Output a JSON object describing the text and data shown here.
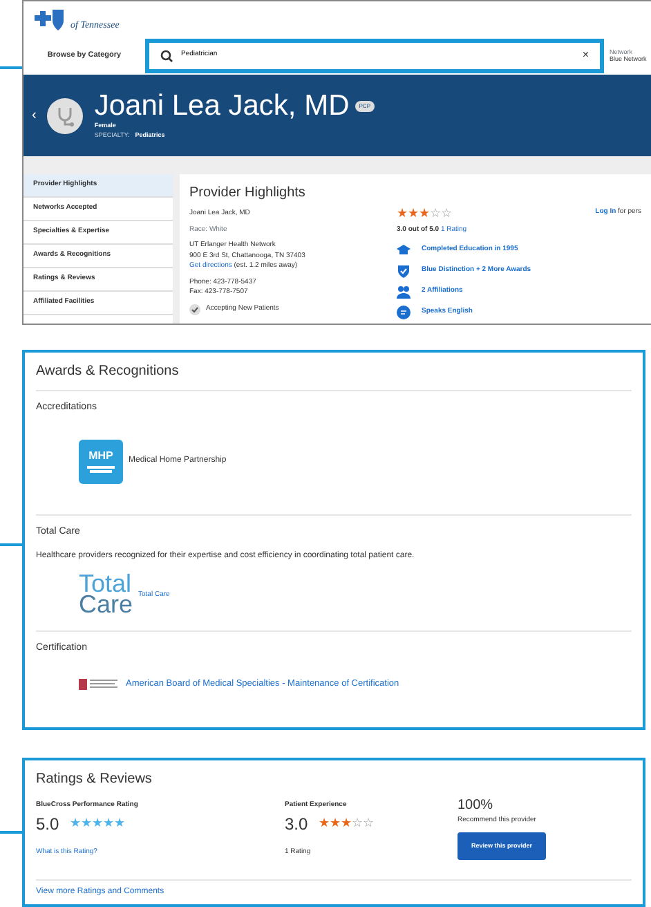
{
  "header": {
    "logo_text": "of Tennessee",
    "browse": "Browse by Category",
    "search": {
      "value": "Pediatrician",
      "clear": "×"
    },
    "network_label": "Network",
    "network_value": "Blue Network"
  },
  "profile": {
    "back": "‹",
    "name": "Joani Lea Jack, MD",
    "badge": "PCP",
    "gender": "Female",
    "specialty_label": "SPECIALTY:",
    "specialty": "Pediatrics"
  },
  "sidebar": {
    "items": [
      {
        "label": "Provider Highlights",
        "selected": true
      },
      {
        "label": "Networks Accepted",
        "selected": false
      },
      {
        "label": "Specialties & Expertise",
        "selected": false
      },
      {
        "label": "Awards & Recognitions",
        "selected": false
      },
      {
        "label": "Ratings & Reviews",
        "selected": false
      },
      {
        "label": "Affiliated Facilities",
        "selected": false
      }
    ]
  },
  "highlights": {
    "title": "Provider Highlights",
    "name": "Joani Lea Jack, MD",
    "race": "Race: White",
    "address_lines": [
      "UT Erlanger Health Network",
      "900 E 3rd St, Chattanooga, TN 37403"
    ],
    "directions_link": "Get directions",
    "directions_note": "(est. 1.2 miles away)",
    "phone": "Phone: 423-778-5437",
    "fax": "Fax: 423-778-7507",
    "accepting": "Accepting New Patients",
    "stars": 3,
    "rating_text": "3.0 out of 5.0",
    "rating_link": "1 Rating",
    "login_link": "Log In",
    "login_suffix": "for pers",
    "features": [
      {
        "kind": "education",
        "text": "Completed Education in 1995"
      },
      {
        "kind": "award",
        "text": "Blue Distinction + 2 More Awards"
      },
      {
        "kind": "affiliation",
        "text": "2 Affiliations"
      },
      {
        "kind": "language",
        "text": "Speaks English"
      }
    ]
  },
  "awards": {
    "title": "Awards & Recognitions",
    "sections": [
      {
        "title": "Accreditations",
        "items": [
          {
            "kind": "mhp",
            "logo_lines": [
              "MHP"
            ],
            "label": "Medical Home Partnership",
            "link": false
          }
        ]
      },
      {
        "title": "Total Care",
        "description": "Healthcare providers recognized for their expertise and cost efficiency in coordinating total patient care.",
        "items": [
          {
            "kind": "totalcare",
            "logo_lines": [
              "Total",
              "Care"
            ],
            "label": "Total Care",
            "link": true
          }
        ]
      },
      {
        "title": "Certification",
        "items": [
          {
            "kind": "abms",
            "label": "American Board of Medical Specialties - Maintenance of Certification",
            "link": true
          }
        ]
      }
    ]
  },
  "ratings": {
    "title": "Ratings & Reviews",
    "bluecross": {
      "label": "BlueCross Performance Rating",
      "score": "5.0",
      "stars": 5,
      "link": "What is this Rating?"
    },
    "patient": {
      "label": "Patient Experience",
      "score": "3.0",
      "stars": 3,
      "count": "1 Rating"
    },
    "recommend": {
      "percent": "100%",
      "label": "Recommend this provider",
      "button": "Review this provider"
    },
    "more_link": "View more Ratings and Comments"
  }
}
